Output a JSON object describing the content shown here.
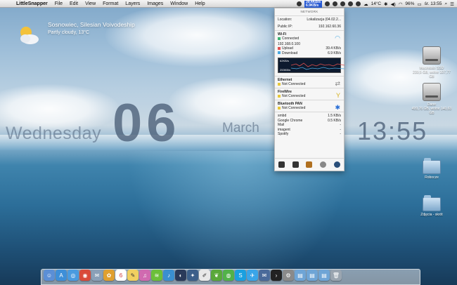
{
  "menubar": {
    "app_name": "LittleSnapper",
    "menus": [
      "File",
      "Edit",
      "View",
      "Format",
      "Layers",
      "Images",
      "Window",
      "Help"
    ],
    "net_up": "39.4KB/s",
    "net_down": "6.9KB/s",
    "temperature": "14°C",
    "battery": "96%",
    "clock": "śr. 13:55"
  },
  "weather": {
    "location": "Sosnowiec, Silesian Voivodeship",
    "condition": "Partly cloudy, 13°C"
  },
  "clock_widget": {
    "day": "Wednesday",
    "date": "06",
    "month": "March",
    "time": "13:55"
  },
  "desktop_icons": [
    {
      "name": "Macintosh SSD",
      "sub": "239,5 GB, wolne 107,77 GB"
    },
    {
      "name": "Dane",
      "sub": "499,76 GB, wolne 140,63 GB"
    },
    {
      "name": "Robocze"
    },
    {
      "name": "Zdjęcia - skrót"
    }
  ],
  "network_panel": {
    "title": "NETWORK",
    "location_label": "Location:",
    "location_value": "Lokalizacja (04.02.2...",
    "public_ip_label": "Public IP:",
    "public_ip_value": "192.162.60.36",
    "wifi": {
      "name": "Wi-Fi",
      "status": "Connected",
      "ip": "192.168.0.100",
      "upload_label": "Upload",
      "upload_value": "39.4 KB/s",
      "download_label": "Download",
      "download_value": "6.9 KB/s",
      "graph_top": "62KB/s",
      "graph_bottom": "253KB/s"
    },
    "ethernet": {
      "name": "Ethernet",
      "status": "Not Connected"
    },
    "firewire": {
      "name": "FireWire",
      "status": "Not Connected"
    },
    "bluetooth": {
      "name": "Bluetooth PAN",
      "status": "Not Connected"
    },
    "apps": [
      {
        "name": "smbd",
        "value": "1.5 KB/s"
      },
      {
        "name": "Google Chrome",
        "value": "0.5 KB/s"
      },
      {
        "name": "Mail",
        "value": "-"
      },
      {
        "name": "imagent",
        "value": "-"
      },
      {
        "name": "Spotify",
        "value": "-"
      }
    ],
    "colors": {
      "connected": "#3cb371",
      "not_connected": "#e8c83a",
      "upload": "#e05050",
      "download": "#4aa8e0"
    }
  },
  "dock": {
    "icons": [
      "finder-icon",
      "app-store-icon",
      "safari-icon",
      "chrome-icon",
      "mail-icon",
      "photos-icon",
      "calendar-icon",
      "notes-icon",
      "itunes-icon",
      "spotify-icon",
      "music-icon",
      "camera-icon",
      "adium-icon",
      "textedit-icon",
      "evernote-icon",
      "messages-icon",
      "skype-icon",
      "twitter-icon",
      "sparrow-icon",
      "terminal-icon",
      "system-prefs-icon",
      "folder-icon",
      "folder-icon",
      "folder-icon",
      "trash-icon"
    ]
  }
}
